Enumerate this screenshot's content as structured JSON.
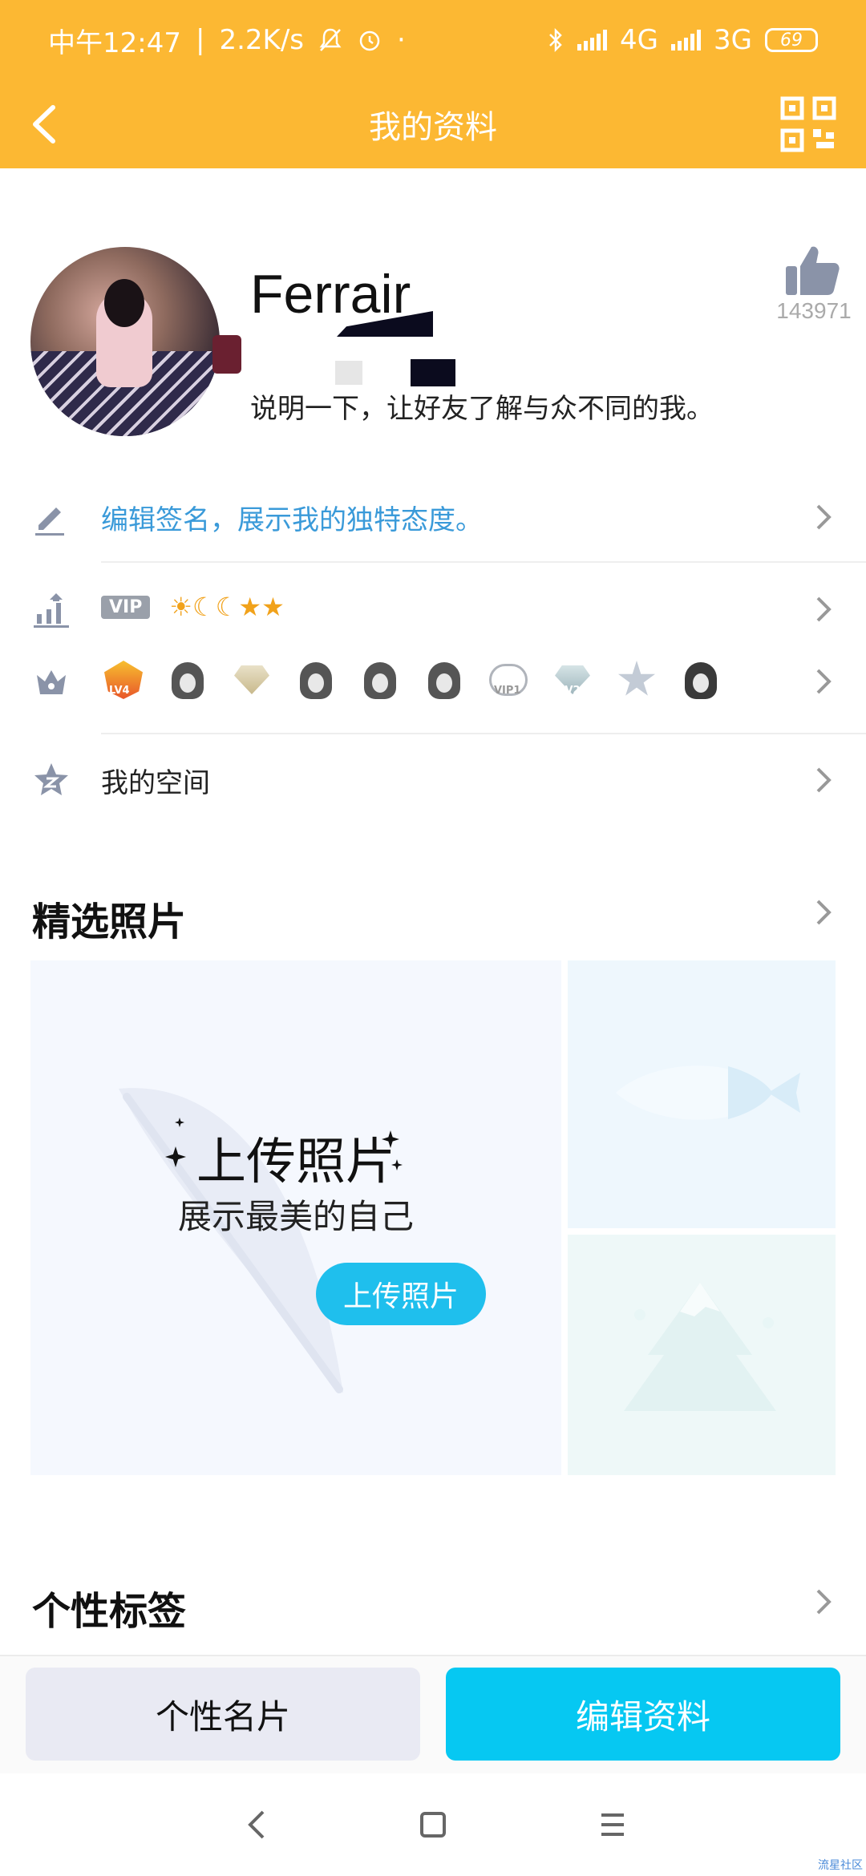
{
  "status_bar": {
    "time": "中午12:47",
    "separator": "|",
    "net_speed": "2.2K/s",
    "mute_icon": "bell-off-icon",
    "alarm_icon": "alarm-icon",
    "dot": "·",
    "bluetooth_icon": "bluetooth-icon",
    "net1": "4G",
    "net2": "3G",
    "battery": "69"
  },
  "nav": {
    "title": "我的资料",
    "back_icon": "back-arrow-icon",
    "qr_icon": "qr-code-icon"
  },
  "profile": {
    "nickname": "Ferrair",
    "intro": "说明一下，让好友了解与众不同的我。",
    "like_count": "143971"
  },
  "rows": {
    "signature_hint": "编辑签名，展示我的独特态度。",
    "vip_tag": "VIP",
    "level_icons": "☀☾☾★★",
    "space": "我的空间"
  },
  "badges": {
    "lv4": "LV4",
    "vip1": "VIP1",
    "lv2": "LV2"
  },
  "photos": {
    "section_title": "精选照片",
    "upload_title": "上传照片",
    "upload_subtitle": "展示最美的自己",
    "upload_button": "上传照片"
  },
  "tags": {
    "section_title": "个性标签"
  },
  "bottom": {
    "card_button": "个性名片",
    "edit_button": "编辑资料"
  },
  "watermark": "流星社区",
  "colors": {
    "header": "#fcb833",
    "accent_blue": "#06c8f2",
    "link_blue": "#3a9ad9"
  }
}
